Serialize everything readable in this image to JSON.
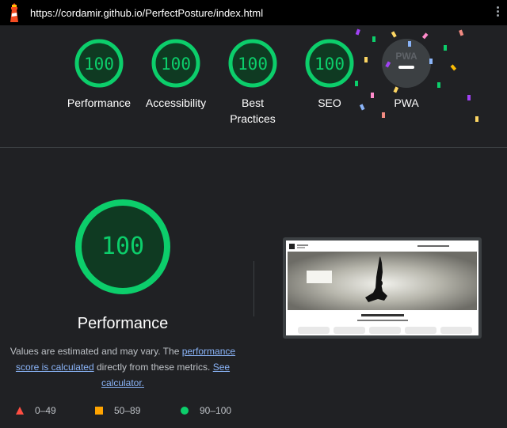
{
  "topbar": {
    "url": "https://cordamir.github.io/PerfectPosture/index.html",
    "logo_icon": "lighthouse-icon",
    "menu_icon": "kebab-menu-icon"
  },
  "gauges": [
    {
      "score": "100",
      "label": "Performance"
    },
    {
      "score": "100",
      "label": "Accessibility"
    },
    {
      "score": "100",
      "label_line1": "Best",
      "label_line2": "Practices"
    },
    {
      "score": "100",
      "label": "SEO"
    },
    {
      "badge": "PWA",
      "badge_icon": "dash-icon",
      "label": "PWA"
    }
  ],
  "main": {
    "score": "100",
    "title": "Performance",
    "desc_text_1": "Values are estimated and may vary. The ",
    "desc_link_1": "performance score is calculated",
    "desc_text_2": " directly from these metrics. ",
    "desc_link_2": "See calculator."
  },
  "legend": [
    {
      "range": "0–49",
      "color": "#ff4e42",
      "icon": "triangle-icon"
    },
    {
      "range": "50–89",
      "color": "#ffa400",
      "icon": "square-icon"
    },
    {
      "range": "90–100",
      "color": "#0cce6b",
      "icon": "circle-icon"
    }
  ],
  "colors": {
    "pass": "#0cce6b",
    "pass_bg": "#0f3a22",
    "background": "#202124"
  }
}
